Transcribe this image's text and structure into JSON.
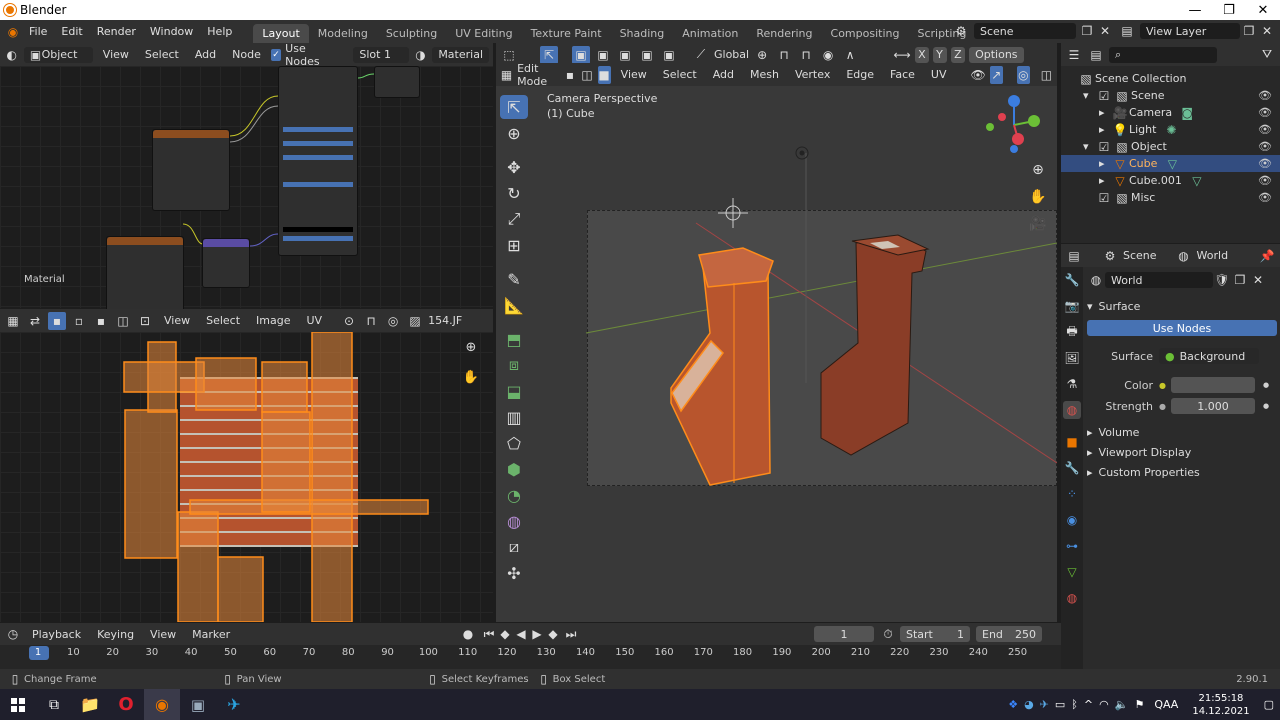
{
  "window": {
    "title": "Blender"
  },
  "menu": [
    "File",
    "Edit",
    "Render",
    "Window",
    "Help"
  ],
  "workspaces": [
    "Layout",
    "Modeling",
    "Sculpting",
    "UV Editing",
    "Texture Paint",
    "Shading",
    "Animation",
    "Rendering",
    "Compositing",
    "Scripting"
  ],
  "active_workspace": "Layout",
  "scene_field": "Scene",
  "viewlayer_field": "View Layer",
  "node_editor": {
    "object_mode": "Object",
    "menus": [
      "View",
      "Select",
      "Add",
      "Node"
    ],
    "use_nodes_label": "Use Nodes",
    "slot": "Slot 1",
    "material": "Material",
    "label": "Material"
  },
  "uv_editor": {
    "menus": [
      "View",
      "Select",
      "Image",
      "UV"
    ],
    "zoom_text": "154.JF"
  },
  "viewport": {
    "mode": "Edit Mode",
    "menus": [
      "View",
      "Select",
      "Add",
      "Mesh",
      "Vertex",
      "Edge",
      "Face",
      "UV"
    ],
    "orientation": "Global",
    "options": "Options",
    "xyz": [
      "X",
      "Y",
      "Z"
    ],
    "overlay_title": "Camera Perspective",
    "overlay_sub": "(1) Cube"
  },
  "outliner": {
    "items": [
      {
        "label": "Scene Collection",
        "indent": 0
      },
      {
        "label": "Scene",
        "indent": 1
      },
      {
        "label": "Camera",
        "indent": 2
      },
      {
        "label": "Light",
        "indent": 2
      },
      {
        "label": "Object",
        "indent": 1
      },
      {
        "label": "Cube",
        "indent": 2,
        "selected": true
      },
      {
        "label": "Cube.001",
        "indent": 2
      },
      {
        "label": "Misc",
        "indent": 1
      }
    ]
  },
  "properties": {
    "tab_scene": "Scene",
    "tab_world": "World",
    "world_name": "World",
    "surface_label": "Surface",
    "use_nodes": "Use Nodes",
    "surface_field_label": "Surface",
    "surface_value": "Background",
    "color_label": "Color",
    "strength_label": "Strength",
    "strength_value": "1.000",
    "sections": [
      "Volume",
      "Viewport Display",
      "Custom Properties"
    ]
  },
  "timeline": {
    "menus": [
      "Playback",
      "Keying",
      "View",
      "Marker"
    ],
    "current_frame": "1",
    "start_label": "Start",
    "start": "1",
    "end_label": "End",
    "end": "250",
    "ticks": [
      "1",
      "10",
      "20",
      "30",
      "40",
      "50",
      "60",
      "70",
      "80",
      "90",
      "100",
      "110",
      "120",
      "130",
      "140",
      "150",
      "160",
      "170",
      "180",
      "190",
      "200",
      "210",
      "220",
      "230",
      "240",
      "250"
    ]
  },
  "status": {
    "left": "Change Frame",
    "mid": "Pan View",
    "k1": "Select Keyframes",
    "k2": "Box Select",
    "version": "2.90.1"
  },
  "taskbar": {
    "lang": "QAA",
    "time": "21:55:18",
    "date": "14.12.2021"
  },
  "colors": {
    "accent": "#4772b3",
    "orange": "#ea7600",
    "selected_row": "#334d80"
  }
}
